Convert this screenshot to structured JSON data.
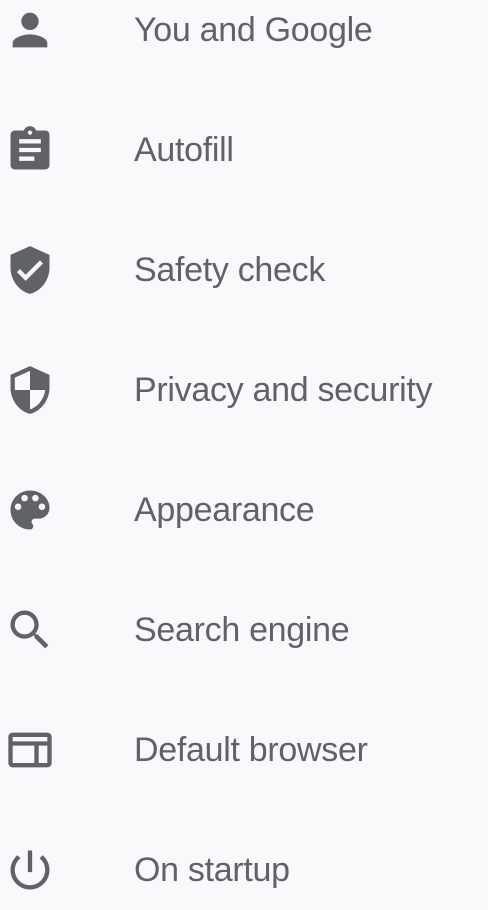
{
  "sidebar": {
    "items": [
      {
        "label": "You and Google",
        "icon": "person-icon"
      },
      {
        "label": "Autofill",
        "icon": "clipboard-icon"
      },
      {
        "label": "Safety check",
        "icon": "shield-check-icon"
      },
      {
        "label": "Privacy and security",
        "icon": "shield-half-icon"
      },
      {
        "label": "Appearance",
        "icon": "palette-icon"
      },
      {
        "label": "Search engine",
        "icon": "search-icon"
      },
      {
        "label": "Default browser",
        "icon": "browser-window-icon"
      },
      {
        "label": "On startup",
        "icon": "power-icon"
      }
    ]
  },
  "colors": {
    "icon": "#5f6368",
    "text": "#5f6368",
    "background": "#f8f9fb"
  }
}
